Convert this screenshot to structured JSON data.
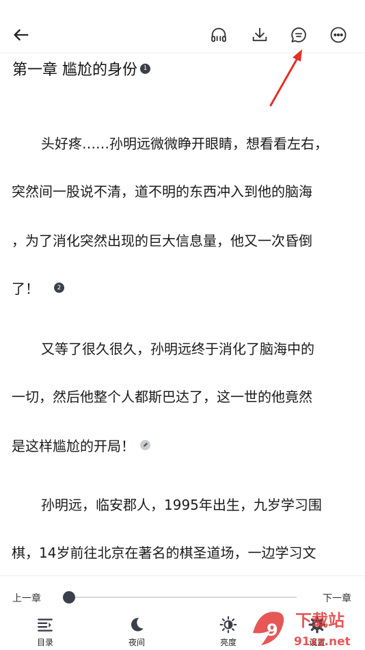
{
  "chapter": {
    "title": "第一章 尴尬的身份",
    "title_badge": "1",
    "lines": [
      {
        "text": "头好疼……孙明远微微睁开眼睛，想看看左右，",
        "indent": true
      },
      {
        "text": "突然间一股说不清，道不明的东西冲入到他的脑海",
        "indent": false
      },
      {
        "text": "，为了消化突然出现的巨大信息量，他又一次昏倒",
        "indent": false
      },
      {
        "text": "了！",
        "indent": false,
        "badge": "2"
      },
      {
        "text": "又等了很久很久，孙明远终于消化了脑海中的",
        "indent": true
      },
      {
        "text": "一切，然后他整个人都斯巴达了，这一世的他竟然",
        "indent": false
      },
      {
        "text": "是这样尴尬的开局！",
        "indent": false,
        "badge_icon": "pencil-icon"
      },
      {
        "text": "孙明远，临安郡人，1995年出生，九岁学习围",
        "indent": true
      },
      {
        "text": "棋，14岁前往北京在著名的棋圣道场，一边学习文",
        "indent": false
      }
    ]
  },
  "bottom": {
    "prev": "上一章",
    "next": "下一章",
    "progress": 0.0,
    "tabs": [
      {
        "id": "catalog",
        "label": "目录",
        "icon": "list-icon"
      },
      {
        "id": "night",
        "label": "夜间",
        "icon": "moon-icon"
      },
      {
        "id": "brightness",
        "label": "亮度",
        "icon": "sun-icon"
      },
      {
        "id": "settings",
        "label": "设置",
        "icon": "gear-icon"
      }
    ]
  },
  "watermark": {
    "text1": "下载站",
    "text2": "91xz.net"
  },
  "colors": {
    "accent_arrow": "#e0302a",
    "icon": "#3a3f4a"
  }
}
